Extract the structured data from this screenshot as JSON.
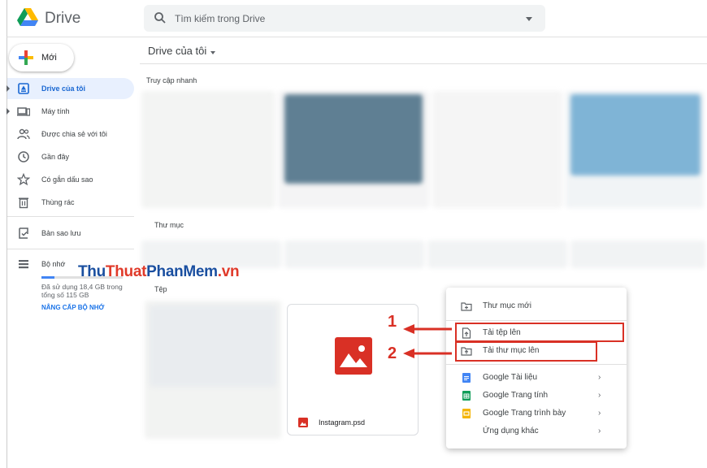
{
  "app": {
    "title": "Drive"
  },
  "search": {
    "placeholder": "Tìm kiếm trong Drive"
  },
  "sidebar": {
    "new_label": "Mới",
    "items": [
      {
        "label": "Drive của tôi",
        "icon": "my-drive-icon",
        "active": true
      },
      {
        "label": "Máy tính",
        "icon": "computer-icon"
      },
      {
        "label": "Được chia sẻ với tôi",
        "icon": "shared-icon"
      },
      {
        "label": "Gần đây",
        "icon": "recent-icon"
      },
      {
        "label": "Có gắn dấu sao",
        "icon": "star-icon"
      },
      {
        "label": "Thùng rác",
        "icon": "trash-icon"
      }
    ],
    "backup_label": "Bản sao lưu",
    "storage_label": "Bộ nhớ",
    "storage_text": "Đã sử dụng 18,4 GB trong tổng số 115 GB",
    "storage_used_fraction": 0.16,
    "upgrade_label": "NÂNG CẤP BỘ NHỚ"
  },
  "main": {
    "breadcrumb": "Drive của tôi",
    "quick_access": "Truy cập nhanh",
    "folders": "Thư mục",
    "files": "Tệp",
    "file_name": "Instagram.psd"
  },
  "watermark": {
    "part1": "Thu",
    "part2": "Thuat",
    "part3": "PhanMem",
    "part4": ".vn"
  },
  "menu": {
    "items": [
      {
        "label": "Thư mục mới",
        "icon": "new-folder-icon"
      },
      {
        "label": "Tải tệp lên",
        "icon": "file-upload-icon"
      },
      {
        "label": "Tải thư mục lên",
        "icon": "folder-upload-icon"
      },
      {
        "label": "Google Tài liệu",
        "icon": "google-docs-icon"
      },
      {
        "label": "Google Trang tính",
        "icon": "google-sheets-icon"
      },
      {
        "label": "Google Trang trình bày",
        "icon": "google-slides-icon"
      },
      {
        "label": "Ứng dụng khác",
        "icon": ""
      }
    ]
  },
  "annotations": {
    "one": "1",
    "two": "2"
  },
  "colors": {
    "accent": "#1a73e8",
    "annotation": "#d93025"
  }
}
